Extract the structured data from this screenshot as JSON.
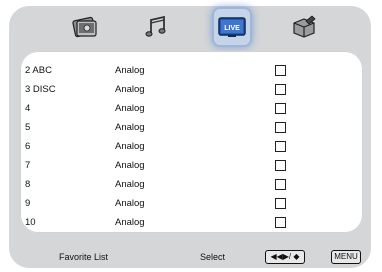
{
  "tabs": [
    {
      "icon": "photo-icon",
      "active": false
    },
    {
      "icon": "music-icon",
      "active": false
    },
    {
      "icon": "live-tv-icon",
      "label": "LIVE",
      "active": true
    },
    {
      "icon": "setup-box-icon",
      "active": false
    }
  ],
  "channels": [
    {
      "number": "2 ABC",
      "type": "Analog",
      "favorite": false
    },
    {
      "number": "3 DISC",
      "type": "Analog",
      "favorite": false
    },
    {
      "number": "4",
      "type": "Analog",
      "favorite": false
    },
    {
      "number": "5",
      "type": "Analog",
      "favorite": false
    },
    {
      "number": "6",
      "type": "Analog",
      "favorite": false
    },
    {
      "number": "7",
      "type": "Analog",
      "favorite": false
    },
    {
      "number": "8",
      "type": "Analog",
      "favorite": false
    },
    {
      "number": "9",
      "type": "Analog",
      "favorite": false
    },
    {
      "number": "10",
      "type": "Analog",
      "favorite": false
    }
  ],
  "footer": {
    "title": "Favorite List",
    "select_label": "Select",
    "nav_key": "◀◀▶/ ◆",
    "menu_key": "MENU"
  },
  "colors": {
    "frame": "#d4d6d8",
    "panel": "#ffffff",
    "active_tab_glow": "#5a8cd2"
  }
}
